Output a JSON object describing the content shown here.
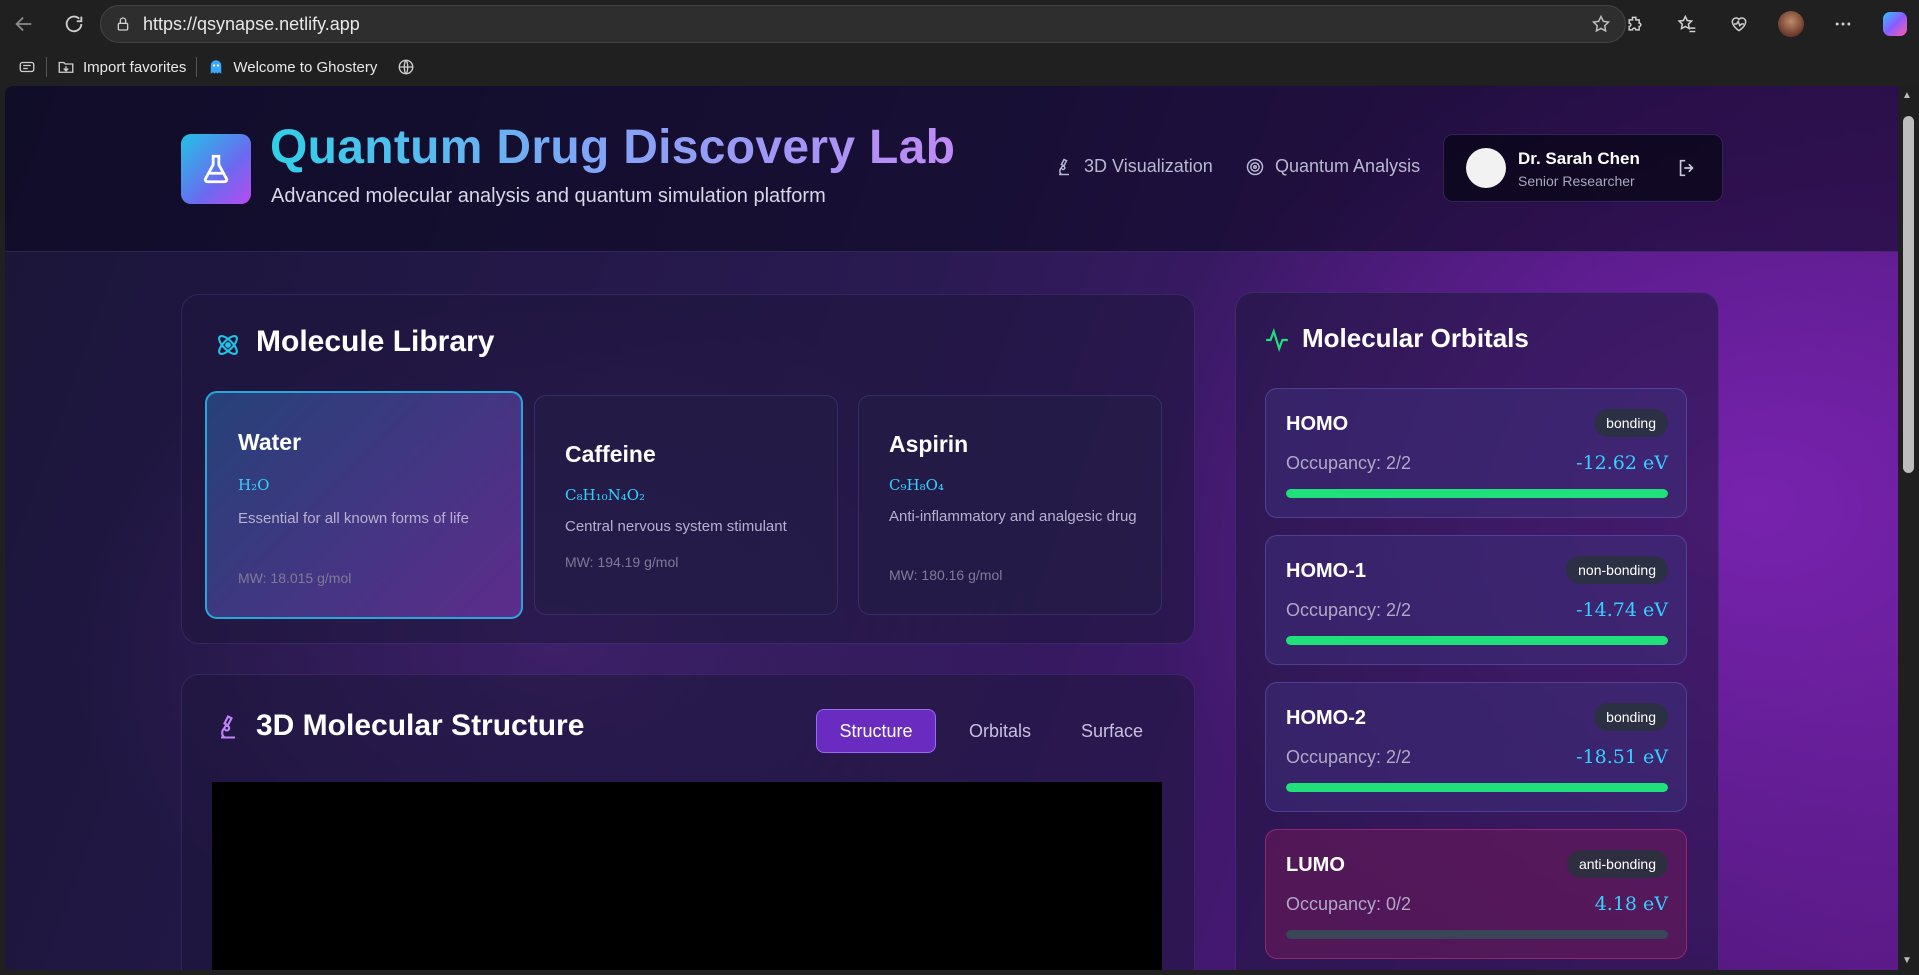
{
  "browser": {
    "url": "https://qsynapse.netlify.app",
    "bookmarks": [
      {
        "label": "Import favorites"
      },
      {
        "label": "Welcome to Ghostery"
      }
    ]
  },
  "header": {
    "title": "Quantum Drug Discovery Lab",
    "subtitle": "Advanced molecular analysis and quantum simulation platform",
    "nav": [
      {
        "label": "3D Visualization",
        "icon": "microscope-icon"
      },
      {
        "label": "Quantum Analysis",
        "icon": "target-icon"
      }
    ],
    "user": {
      "name": "Dr. Sarah Chen",
      "role": "Senior Researcher"
    }
  },
  "library": {
    "title": "Molecule Library",
    "molecules": [
      {
        "name": "Water",
        "formula": "H₂O",
        "description": "Essential for all known forms of life",
        "mw": "MW: 18.015 g/mol",
        "selected": true
      },
      {
        "name": "Caffeine",
        "formula": "C₈H₁₀N₄O₂",
        "description": "Central nervous system stimulant",
        "mw": "MW: 194.19 g/mol",
        "selected": false
      },
      {
        "name": "Aspirin",
        "formula": "C₉H₈O₄",
        "description": "Anti-inflammatory and analgesic drug",
        "mw": "MW: 180.16 g/mol",
        "selected": false
      }
    ]
  },
  "structure": {
    "title": "3D Molecular Structure",
    "tabs": [
      {
        "label": "Structure",
        "active": true
      },
      {
        "label": "Orbitals",
        "active": false
      },
      {
        "label": "Surface",
        "active": false
      }
    ]
  },
  "orbitals": {
    "title": "Molecular Orbitals",
    "items": [
      {
        "name": "HOMO",
        "type": "bonding",
        "occupancy": "Occupancy: 2/2",
        "energy": "-12.62 eV",
        "fill": 1.0
      },
      {
        "name": "HOMO-1",
        "type": "non-bonding",
        "occupancy": "Occupancy: 2/2",
        "energy": "-14.74 eV",
        "fill": 1.0
      },
      {
        "name": "HOMO-2",
        "type": "bonding",
        "occupancy": "Occupancy: 2/2",
        "energy": "-18.51 eV",
        "fill": 1.0
      },
      {
        "name": "LUMO",
        "type": "anti-bonding",
        "occupancy": "Occupancy: 0/2",
        "energy": "4.18 eV",
        "fill": 0.0
      }
    ]
  },
  "colors": {
    "accent_cyan": "#35d0ff",
    "occupancy_green": "#1fe07a",
    "active_tab": "#6a2cc0"
  }
}
